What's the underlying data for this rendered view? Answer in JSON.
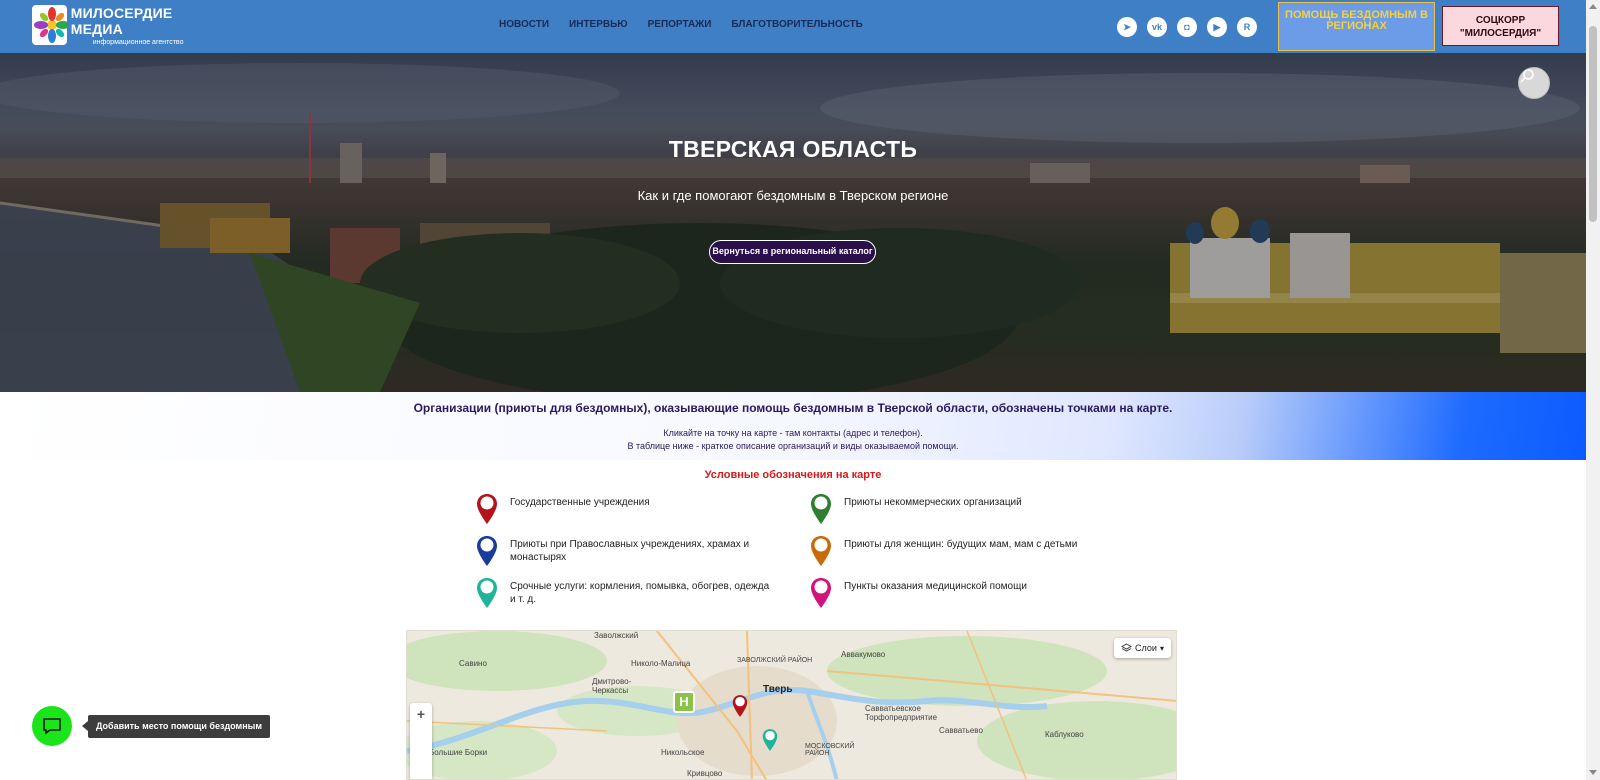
{
  "header": {
    "logo": {
      "title": "МИЛОСЕРДИЕ МЕДИА",
      "subtitle": "информационное агентство"
    },
    "nav": [
      {
        "label": "НОВОСТИ"
      },
      {
        "label": "ИНТЕРВЬЮ"
      },
      {
        "label": "РЕПОРТАЖИ"
      },
      {
        "label": "БЛАГОТВОРИТЕЛЬНОСТЬ"
      }
    ],
    "socials": [
      {
        "icon": "telegram-icon",
        "glyph": "➤"
      },
      {
        "icon": "vk-icon",
        "glyph": "vk"
      },
      {
        "icon": "odnoklassniki-icon",
        "glyph": "◘"
      },
      {
        "icon": "video-icon",
        "glyph": "▶"
      },
      {
        "icon": "rutube-icon",
        "glyph": "R"
      }
    ],
    "help_button": "ПОМОЩЬ БЕЗДОМНЫМ В РЕГИОНАХ",
    "soc_button": "СОЦКОРР \"МИЛОСЕРДИЯ\""
  },
  "hero": {
    "title": "ТВЕРСКАЯ ОБЛАСТЬ",
    "subtitle": "Как и где помогают бездомным в Тверском регионе",
    "button": "Вернуться в региональный каталог"
  },
  "band": {
    "title": "Организации (приюты для бездомных), оказывающие помощь бездомным в Тверской области, обозначены точками на карте.",
    "line1": "Кликайте на точку на карте - там контакты (адрес и телефон).",
    "line2": "В таблице ниже - краткое описание организаций и виды оказываемой помощи."
  },
  "legend": {
    "title": "Условные обозначения на карте",
    "items": [
      {
        "label": "Государственные учреждения",
        "color": "#b3141c"
      },
      {
        "label": "Приюты некоммерческих организаций",
        "color": "#2e7d32"
      },
      {
        "label": "Приюты при Православных учреждениях, храмах и монастырях",
        "color": "#1a3a9e"
      },
      {
        "label": "Приюты для женщин: будущих мам, мам с детьми",
        "color": "#c96a0a"
      },
      {
        "label": "Срочные услуги: кормления, помывка, обогрев, одежда и т. д.",
        "color": "#1fb39a"
      },
      {
        "label": "Пункты оказания медицинской помощи",
        "color": "#d4127a"
      }
    ]
  },
  "map": {
    "layers_label": "Слои",
    "zoom_in": "+",
    "zoom_out": "−",
    "places": {
      "zavolzhsky": "Заволжский",
      "savino": "Савино",
      "nikolo_malitsa": "Николо-Малица",
      "zavolzhsky_district": "ЗАВОЛЖСКИЙ РАЙОН",
      "avvakumovo": "Аввакумово",
      "dmitrovo": "Дмитрово-Черкассы",
      "tver": "Тверь",
      "savvatyevskoe": "Савватьевское Торфопредприятие",
      "savvatyevo": "Савватьево",
      "kablukovo": "Каблуково",
      "bolshie_borki": "Большие Борки",
      "nikolskoe": "Никольское",
      "moskovsky": "МОСКОВСКИЙ РАЙОН",
      "krivtsovo": "Кривцово"
    }
  },
  "chat": {
    "tooltip": "Добавить место помощи бездомным"
  }
}
